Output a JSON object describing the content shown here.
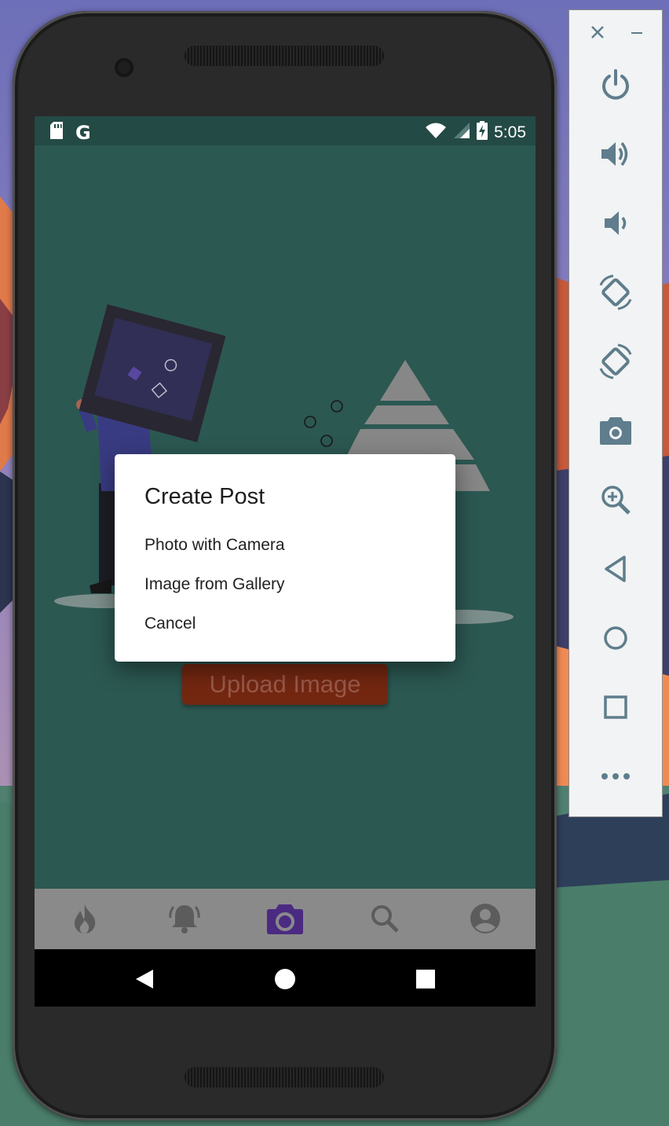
{
  "status_bar": {
    "time": "5:05",
    "left_icons": [
      "sd-card-icon",
      "google-icon"
    ],
    "google_letter": "G",
    "right_icons": [
      "wifi-icon",
      "cell-signal-icon",
      "battery-charging-icon"
    ]
  },
  "main": {
    "upload_button_label": "Upload Image"
  },
  "dialog": {
    "title": "Create Post",
    "options": [
      "Photo with Camera",
      "Image from Gallery",
      "Cancel"
    ]
  },
  "bottom_nav": {
    "items": [
      "flame-icon",
      "notifications-icon",
      "camera-icon",
      "search-icon",
      "account-icon"
    ],
    "active_index": 2
  },
  "system_nav": [
    "back-icon",
    "home-icon",
    "recents-icon"
  ],
  "emulator_toolbar": {
    "window_controls": [
      "close-icon",
      "minimize-icon"
    ],
    "buttons": [
      "power-icon",
      "volume-up-icon",
      "volume-down-icon",
      "rotate-left-icon",
      "rotate-right-icon",
      "screenshot-icon",
      "zoom-icon",
      "back-icon",
      "home-icon",
      "overview-icon",
      "more-icon"
    ]
  },
  "colors": {
    "app_background": "#2f5d57",
    "status_bar": "#244a46",
    "upload_button": "#7a2a12",
    "bottom_nav": "#8a8a8a",
    "active_nav": "#4b2a82",
    "toolbar_icon": "#5f7d8c"
  }
}
